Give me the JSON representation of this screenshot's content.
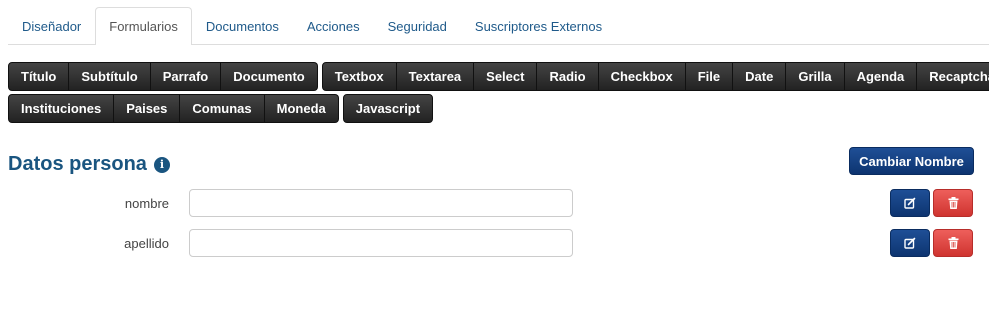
{
  "tabs": [
    {
      "label": "Diseñador"
    },
    {
      "label": "Formularios",
      "active": true
    },
    {
      "label": "Documentos"
    },
    {
      "label": "Acciones"
    },
    {
      "label": "Seguridad"
    },
    {
      "label": "Suscriptores Externos"
    }
  ],
  "toolbar": {
    "group1": [
      "Título",
      "Subtítulo",
      "Parrafo",
      "Documento"
    ],
    "group2": [
      "Textbox",
      "Textarea",
      "Select",
      "Radio",
      "Checkbox",
      "File",
      "Date",
      "Grilla",
      "Agenda",
      "Recaptcha"
    ],
    "group3": [
      "Instituciones",
      "Paises",
      "Comunas",
      "Moneda"
    ],
    "group4": [
      "Javascript"
    ]
  },
  "section": {
    "title": "Datos persona",
    "info_icon": "info-circle-icon",
    "rename_label": "Cambiar Nombre"
  },
  "fields": [
    {
      "label": "nombre",
      "value": ""
    },
    {
      "label": "apellido",
      "value": ""
    }
  ],
  "icons": {
    "edit": "edit-square-icon",
    "delete": "trash-icon"
  },
  "colors": {
    "tab_link": "#1f5a8a",
    "title": "#1a5580",
    "primary": "#0d3470",
    "danger": "#dd4b47",
    "toolbar": "#2a2a2a"
  }
}
